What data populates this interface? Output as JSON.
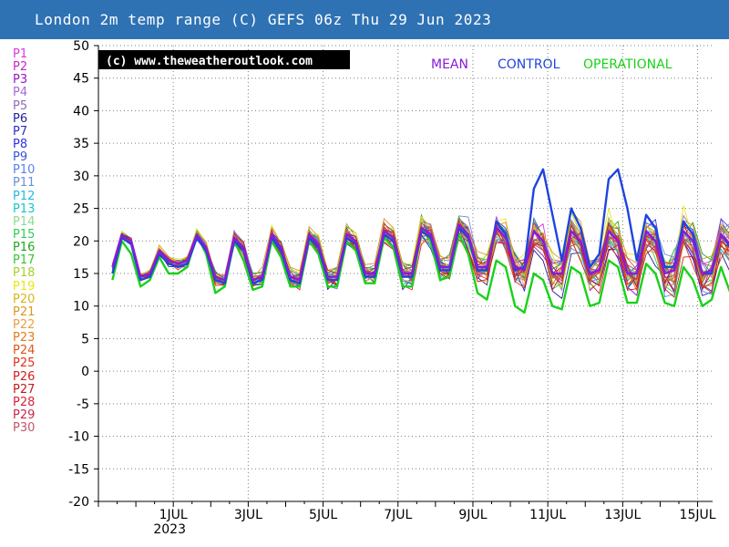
{
  "header": {
    "title": "London 2m temp range (C) GEFS 06z Thu 29 Jun 2023"
  },
  "colors": {
    "header_bg": "#2e72b4",
    "mean": "#8a1adb",
    "control": "#1f44e0",
    "operational": "#19d119",
    "grid": "#7f7f7f"
  },
  "legend": {
    "members": [
      {
        "label": "P1",
        "color": "#e233e2"
      },
      {
        "label": "P2",
        "color": "#cc22cc"
      },
      {
        "label": "P3",
        "color": "#9a17c4"
      },
      {
        "label": "P4",
        "color": "#a26bd8"
      },
      {
        "label": "P5",
        "color": "#8f6bbf"
      },
      {
        "label": "P6",
        "color": "#241f9c"
      },
      {
        "label": "P7",
        "color": "#2d2dc9"
      },
      {
        "label": "P8",
        "color": "#3131e6"
      },
      {
        "label": "P9",
        "color": "#3a56d8"
      },
      {
        "label": "P10",
        "color": "#5b82e8"
      },
      {
        "label": "P11",
        "color": "#6b8fd9"
      },
      {
        "label": "P12",
        "color": "#22b7e0"
      },
      {
        "label": "P13",
        "color": "#17c6c6"
      },
      {
        "label": "P14",
        "color": "#8edb8e"
      },
      {
        "label": "P15",
        "color": "#33cc55"
      },
      {
        "label": "P16",
        "color": "#1fa81f"
      },
      {
        "label": "P17",
        "color": "#36c436"
      },
      {
        "label": "P18",
        "color": "#a6d12a"
      },
      {
        "label": "P19",
        "color": "#e6e61a"
      },
      {
        "label": "P20",
        "color": "#d9b61c"
      },
      {
        "label": "P21",
        "color": "#d99a1a"
      },
      {
        "label": "P22",
        "color": "#e8a040"
      },
      {
        "label": "P23",
        "color": "#e07b1a"
      },
      {
        "label": "P24",
        "color": "#d9581a"
      },
      {
        "label": "P25",
        "color": "#e0301a"
      },
      {
        "label": "P26",
        "color": "#d11f1f"
      },
      {
        "label": "P27",
        "color": "#c21a1a"
      },
      {
        "label": "P28",
        "color": "#d4243a"
      },
      {
        "label": "P29",
        "color": "#c42a4a"
      },
      {
        "label": "P30",
        "color": "#c4556a"
      }
    ]
  },
  "chart_data": {
    "type": "line",
    "title": "London 2m temp range (C) GEFS 06z Thu 29 Jun 2023",
    "xlabel": "",
    "ylabel": "",
    "ylim": [
      -20,
      50
    ],
    "yticks": [
      -20,
      -15,
      -10,
      -5,
      0,
      5,
      10,
      15,
      20,
      25,
      30,
      35,
      40,
      45,
      50
    ],
    "x_range_days": [
      29.0,
      45.4
    ],
    "xticks": [
      {
        "day": 31,
        "label": "1JUL",
        "sublabel": "2023"
      },
      {
        "day": 33,
        "label": "3JUL",
        "sublabel": ""
      },
      {
        "day": 35,
        "label": "5JUL",
        "sublabel": ""
      },
      {
        "day": 37,
        "label": "7JUL",
        "sublabel": ""
      },
      {
        "day": 39,
        "label": "9JUL",
        "sublabel": ""
      },
      {
        "day": 41,
        "label": "11JUL",
        "sublabel": ""
      },
      {
        "day": 43,
        "label": "13JUL",
        "sublabel": ""
      },
      {
        "day": 45,
        "label": "15JUL",
        "sublabel": ""
      }
    ],
    "x_start": "2023-06-29 09:00",
    "step_hours": 6,
    "watermark": "(c) www.theweatheroutlook.com",
    "legend_entries": [
      {
        "name": "MEAN",
        "color": "#8a1adb"
      },
      {
        "name": "CONTROL",
        "color": "#1f44e0"
      },
      {
        "name": "OPERATIONAL",
        "color": "#19d119"
      }
    ],
    "legend_placement": "top-right",
    "grid": true,
    "series": [
      {
        "name": "MEAN",
        "values": [
          16,
          21,
          20,
          14.5,
          15,
          18.5,
          17,
          16.5,
          17,
          21,
          19,
          14.5,
          14,
          20.5,
          19,
          14,
          14.5,
          21,
          19,
          14.5,
          14,
          21,
          19.5,
          14.5,
          14.5,
          21,
          20,
          15,
          15,
          21.5,
          20.5,
          15,
          15,
          22,
          21,
          16,
          16,
          22.5,
          21,
          16,
          16,
          22,
          20.5,
          16,
          15.5,
          21.5,
          20,
          15,
          15,
          21.5,
          20,
          15,
          15.5,
          21.5,
          20,
          15,
          15,
          21.5,
          20,
          15,
          15.5,
          21.5,
          20,
          15,
          15.5,
          21,
          19.5,
          15
        ]
      },
      {
        "name": "CONTROL",
        "values": [
          15,
          20.5,
          19.5,
          14,
          14.5,
          18,
          16.5,
          16,
          16.5,
          20.5,
          18.5,
          14,
          13.5,
          20,
          18.5,
          13.5,
          14,
          20.5,
          18.5,
          14,
          13.5,
          20.5,
          19,
          14,
          14,
          20.5,
          19.5,
          14.5,
          14.5,
          21,
          20,
          14.5,
          14.5,
          21.5,
          20.5,
          15.5,
          15.5,
          22,
          20.5,
          15.5,
          15.5,
          23,
          21,
          15.5,
          16,
          28,
          31,
          24,
          17,
          25,
          22,
          16,
          18,
          29.5,
          31,
          25,
          17,
          24,
          22,
          16,
          16,
          23,
          21,
          15,
          15,
          21,
          19,
          14
        ]
      },
      {
        "name": "OPERATIONAL",
        "values": [
          14,
          20,
          18,
          13,
          14,
          17.5,
          15,
          15,
          16,
          21,
          18,
          12,
          13,
          20,
          17,
          12.5,
          13,
          20,
          17.5,
          13,
          13,
          20,
          18,
          13,
          13,
          20,
          18.5,
          13.5,
          13.5,
          20.5,
          19,
          13,
          13,
          22,
          20,
          14,
          14.5,
          21,
          18,
          12,
          11,
          17,
          16,
          10,
          9,
          15,
          14,
          10,
          9.5,
          16,
          15,
          10,
          10.5,
          17,
          16,
          10.5,
          10.5,
          16.5,
          15,
          10.5,
          10,
          16,
          14,
          10,
          11,
          16,
          12,
          8.5
        ]
      }
    ]
  }
}
